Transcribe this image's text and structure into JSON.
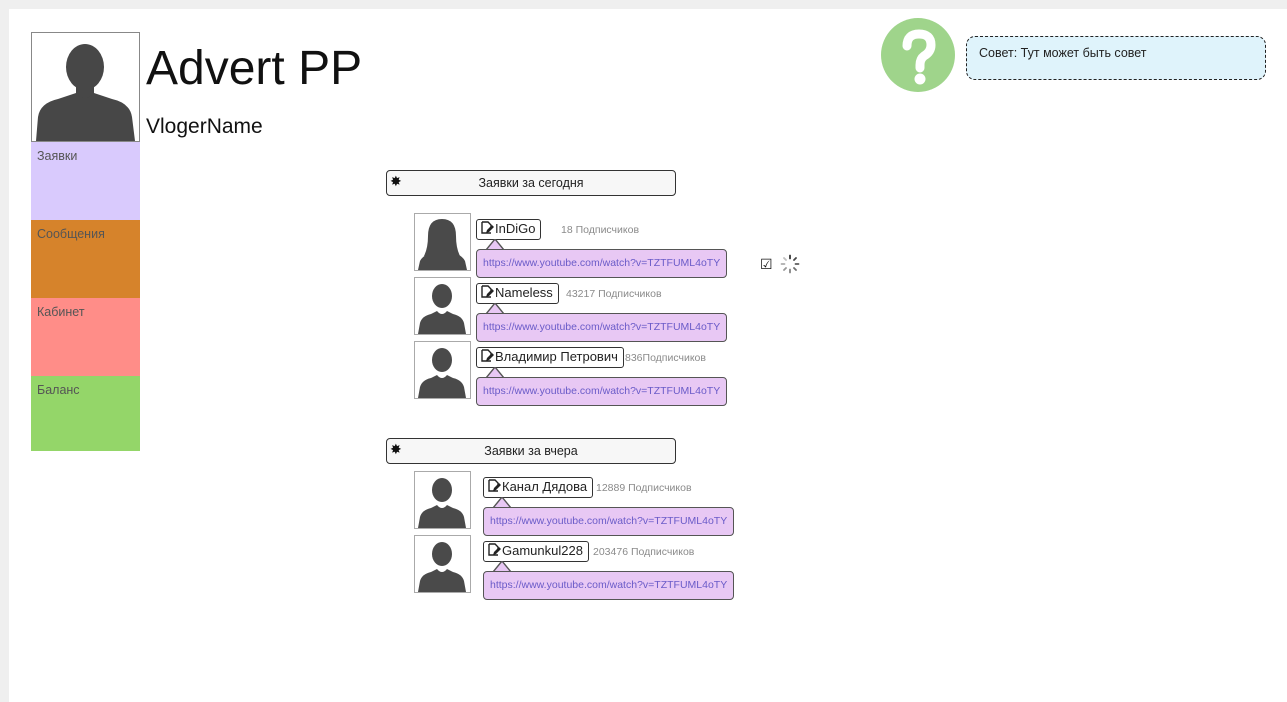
{
  "app": {
    "title": "Advert PP",
    "vlogger_name": "VlogerName"
  },
  "sidebar": {
    "items": [
      {
        "label": "Заявки",
        "color": "#d9cafd"
      },
      {
        "label": "Сообщения",
        "color": "#d6832b"
      },
      {
        "label": "Кабинет",
        "color": "#ff8d88"
      },
      {
        "label": "Баланс",
        "color": "#94d669"
      }
    ]
  },
  "help": {
    "icon": "question-mark-icon",
    "tip": "Совет: Тут может быть совет"
  },
  "sections": [
    {
      "title": "Заявки за сегодня",
      "entries": [
        {
          "name": "InDiGo",
          "subscribers": "18 Подписчиков",
          "url": "https://www.youtube.com/watch?v=TZTFUML4oTY",
          "avatar": "female-avatar-icon"
        },
        {
          "name": "Nameless",
          "subscribers": "43217 Подписчиков",
          "url": "https://www.youtube.com/watch?v=TZTFUML4oTY",
          "avatar": "male-avatar-icon"
        },
        {
          "name": "Владимир Петрович",
          "subscribers": "836Подписчиков",
          "url": "https://www.youtube.com/watch?v=TZTFUML4oTY",
          "avatar": "male-avatar-icon"
        }
      ]
    },
    {
      "title": "Заявки за вчера",
      "entries": [
        {
          "name": "Канал Дядова",
          "subscribers": "12889 Подписчиков",
          "url": "https://www.youtube.com/watch?v=TZTFUML4oTY",
          "avatar": "male-avatar-icon"
        },
        {
          "name": "Gamunkul228",
          "subscribers": "203476 Подписчиков",
          "url": "https://www.youtube.com/watch?v=TZTFUML4oTY",
          "avatar": "male-avatar-icon"
        }
      ]
    }
  ],
  "icons": {
    "section": "gear-icon",
    "name_tag": "edit-icon",
    "accept": "checkbox-checked-icon",
    "loading": "spinner-icon"
  }
}
